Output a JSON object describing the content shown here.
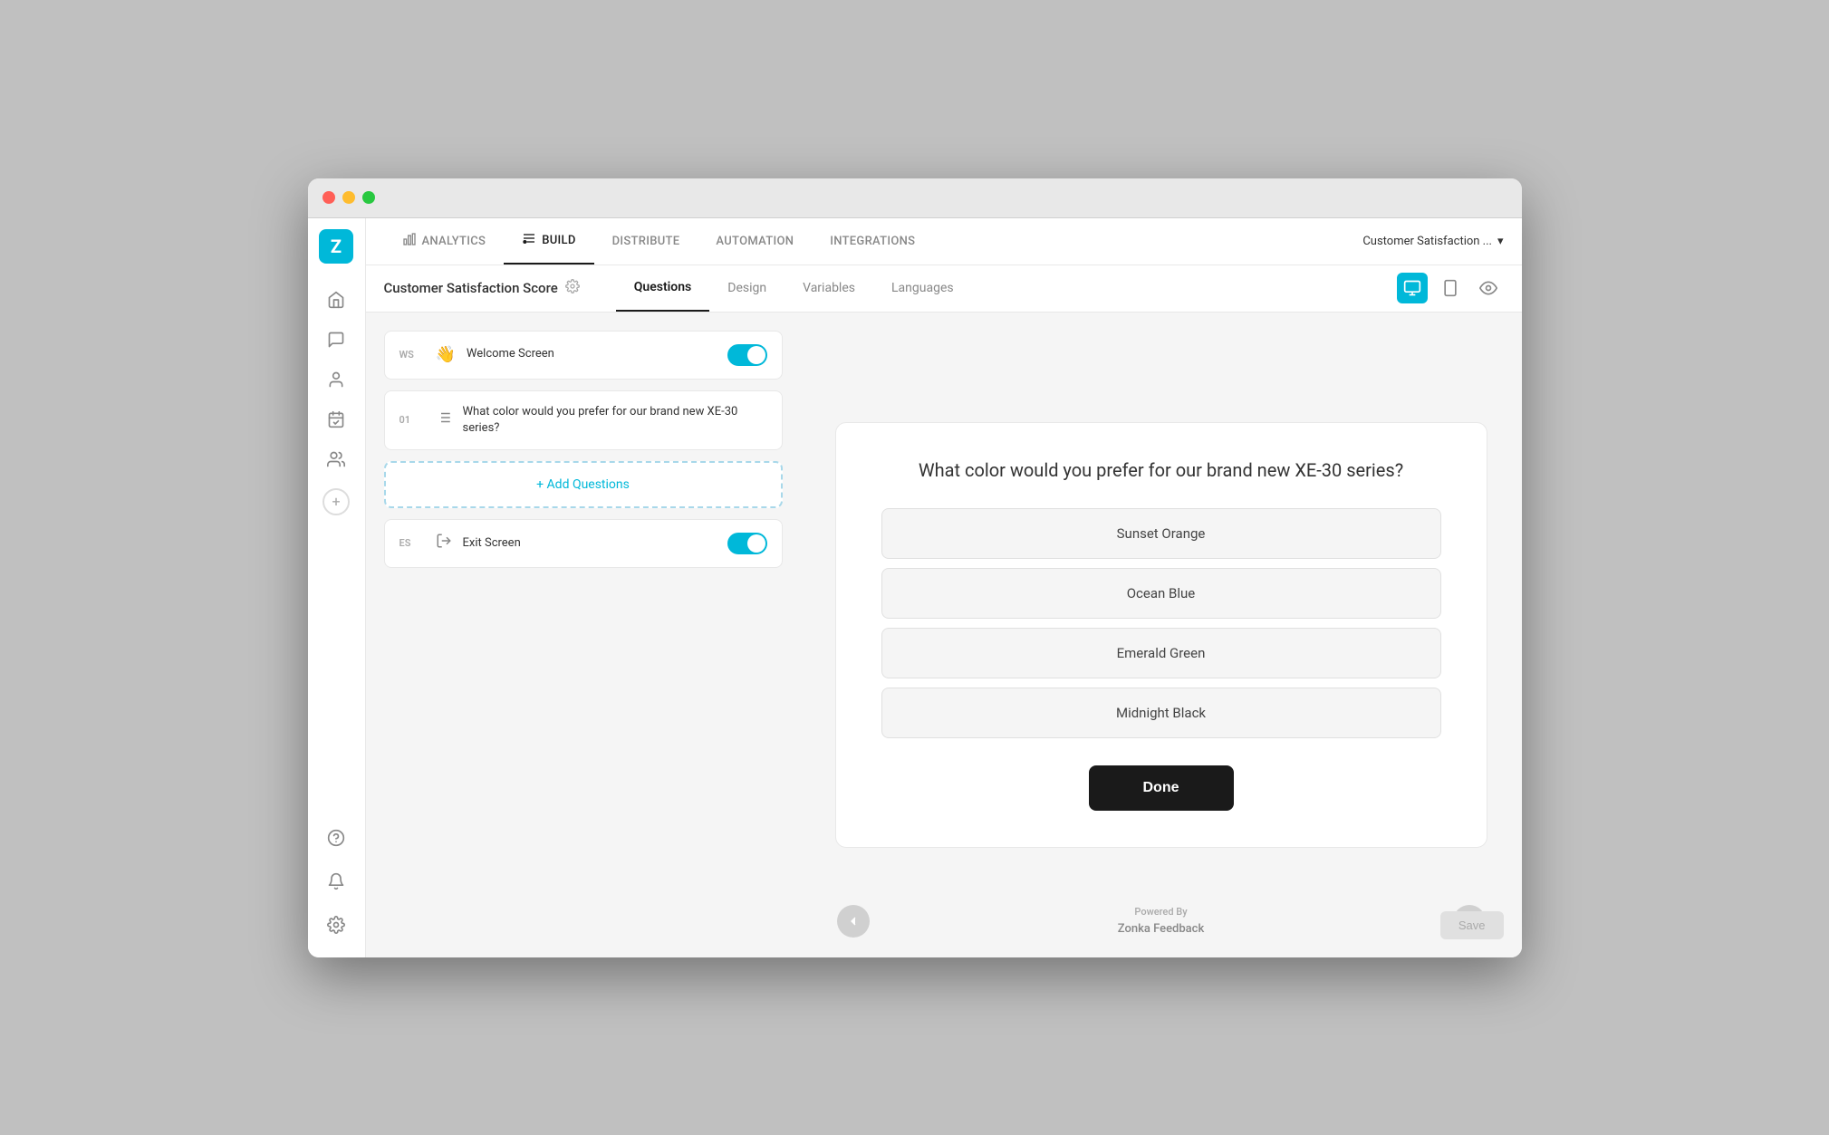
{
  "window": {
    "title": "Zonka Feedback"
  },
  "nav": {
    "items": [
      {
        "id": "analytics",
        "label": "ANALYTICS",
        "icon": "📊",
        "active": false
      },
      {
        "id": "build",
        "label": "BUILD",
        "icon": "⚙️",
        "active": true
      },
      {
        "id": "distribute",
        "label": "DISTRIBUTE",
        "icon": "",
        "active": false
      },
      {
        "id": "automation",
        "label": "AUTOMATION",
        "icon": "",
        "active": false
      },
      {
        "id": "integrations",
        "label": "INTEGRATIONS",
        "icon": "",
        "active": false
      }
    ],
    "survey_selector_label": "Customer Satisfaction ..."
  },
  "sub_header": {
    "title": "Customer Satisfaction Score",
    "tabs": [
      {
        "id": "questions",
        "label": "Questions",
        "active": true
      },
      {
        "id": "design",
        "label": "Design",
        "active": false
      },
      {
        "id": "variables",
        "label": "Variables",
        "active": false
      },
      {
        "id": "languages",
        "label": "Languages",
        "active": false
      }
    ]
  },
  "sidebar": {
    "logo": "Z",
    "icons": [
      {
        "id": "home",
        "icon": "⌂"
      },
      {
        "id": "messages",
        "icon": "💬"
      },
      {
        "id": "contacts",
        "icon": "👤"
      },
      {
        "id": "tasks",
        "icon": "📋"
      },
      {
        "id": "team",
        "icon": "👥"
      }
    ],
    "bottom_icons": [
      {
        "id": "help",
        "icon": "?"
      },
      {
        "id": "notifications",
        "icon": "🔔"
      },
      {
        "id": "settings",
        "icon": "⚙"
      }
    ]
  },
  "questions_panel": {
    "welcome_screen": {
      "label": "WS",
      "text": "Welcome Screen",
      "toggle": true
    },
    "questions": [
      {
        "number": "01",
        "text": "What color would you prefer for our brand new XE-30 series?"
      }
    ],
    "add_button_label": "+ Add Questions",
    "exit_screen": {
      "label": "ES",
      "text": "Exit Screen",
      "toggle": true
    }
  },
  "preview": {
    "question": "What color would you prefer for our brand new XE-30 series?",
    "choices": [
      {
        "id": "1",
        "label": "Sunset Orange"
      },
      {
        "id": "2",
        "label": "Ocean Blue"
      },
      {
        "id": "3",
        "label": "Emerald Green"
      },
      {
        "id": "4",
        "label": "Midnight Black"
      }
    ],
    "done_button": "Done",
    "powered_by_line1": "Powered By",
    "powered_by_line2": "Zonka Feedback",
    "save_button": "Save"
  }
}
